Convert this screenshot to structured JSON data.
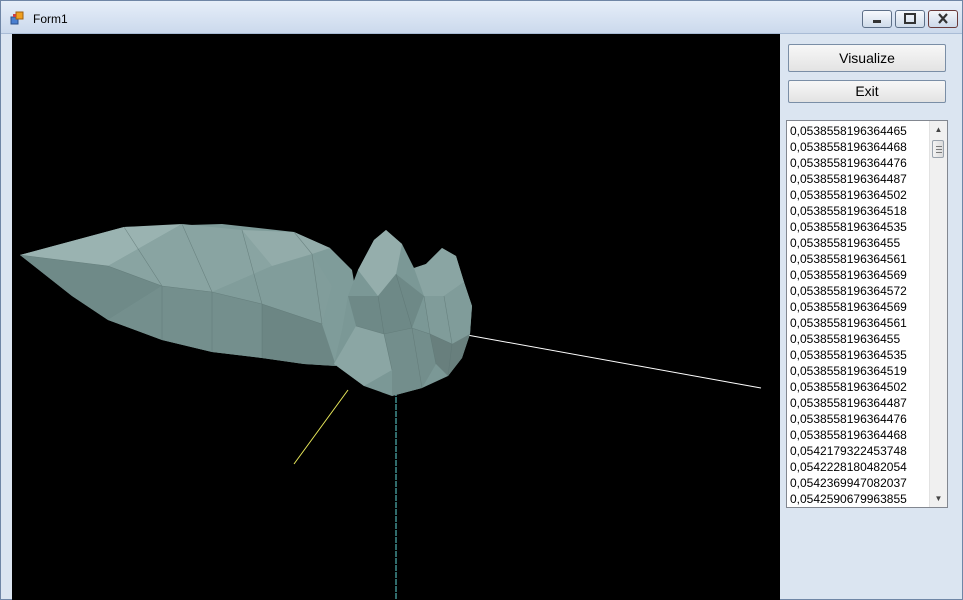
{
  "window": {
    "title": "Form1",
    "controls": {
      "minimize": "minimize",
      "maximize": "maximize",
      "close": "close"
    }
  },
  "buttons": {
    "visualize": "Visualize",
    "exit": "Exit"
  },
  "listbox": {
    "items": [
      "0,0538558196364465",
      "0,0538558196364468",
      "0,0538558196364476",
      "0,0538558196364487",
      "0,0538558196364502",
      "0,0538558196364518",
      "0,0538558196364535",
      "0,053855819636455",
      "0,0538558196364561",
      "0,0538558196364569",
      "0,0538558196364572",
      "0,0538558196364569",
      "0,0538558196364561",
      "0,053855819636455",
      "0,0538558196364535",
      "0,0538558196364519",
      "0,0538558196364502",
      "0,0538558196364487",
      "0,0538558196364476",
      "0,0538558196364468",
      "0,0542179322453748",
      "0,0542228180482054",
      "0,0542369947082037",
      "0,0542590679963855"
    ]
  },
  "scene": {
    "background": "#000000",
    "mesh_color": "#7f9c9a",
    "axis_colors": {
      "x": "#ffffff",
      "y": "#5fd6d6",
      "z": "#e8e85a"
    }
  }
}
